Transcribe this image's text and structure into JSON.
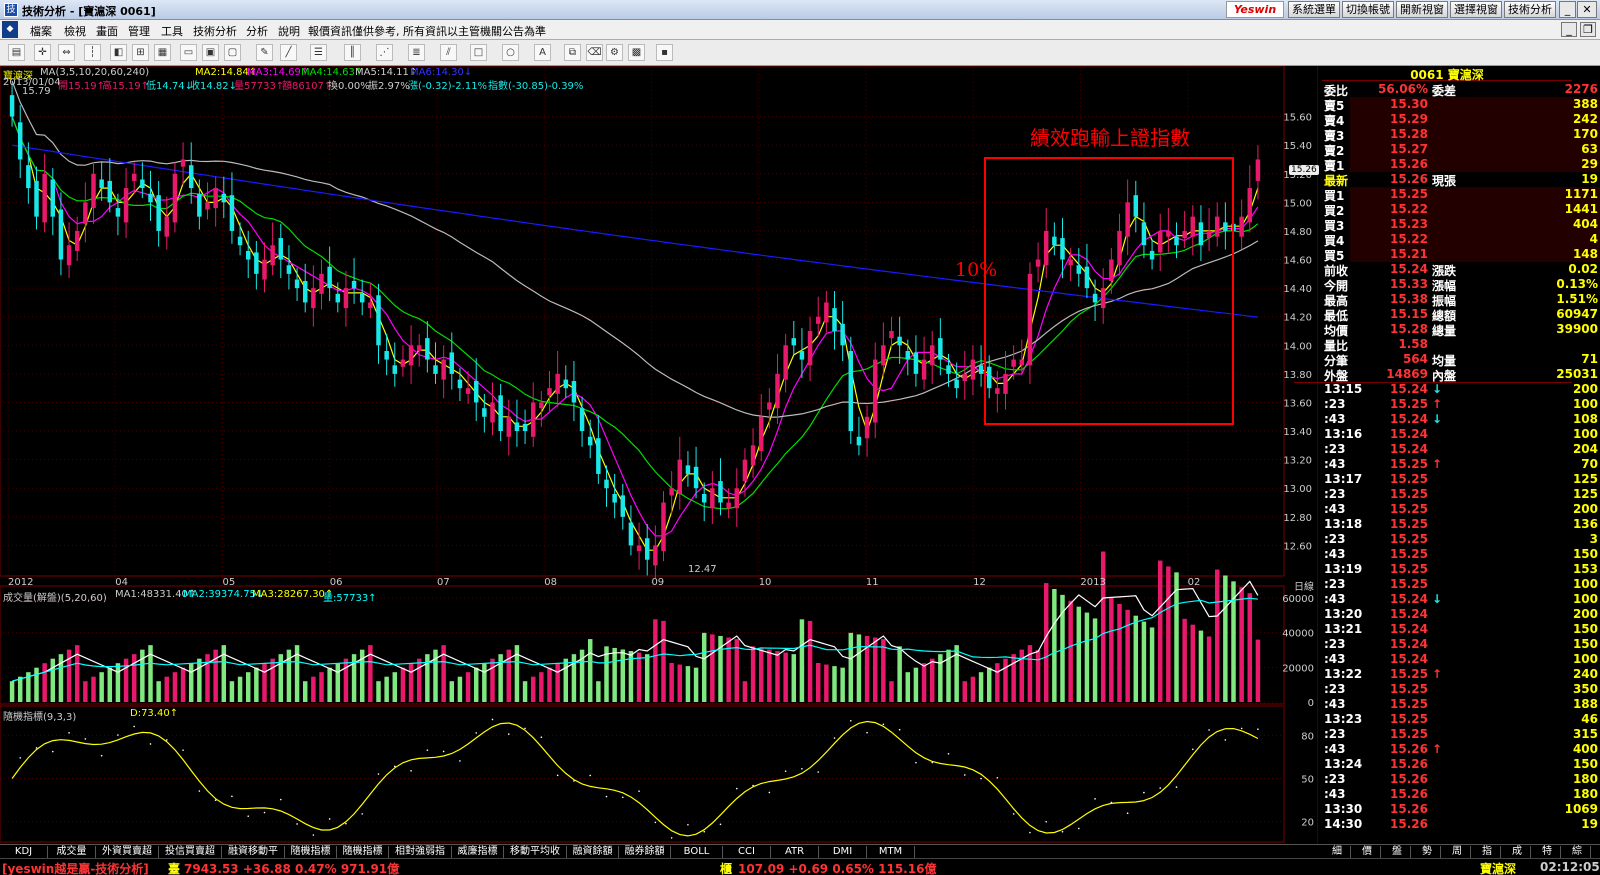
{
  "window": {
    "title": "技術分析 - [寶滬深 0061]",
    "brand": "Yeswin",
    "top_buttons": [
      "系統選單",
      "切換帳號",
      "開新視窗",
      "選擇視窗",
      "技術分析"
    ]
  },
  "menu": {
    "items": [
      "檔案",
      "檢視",
      "畫面",
      "管理",
      "工具",
      "技術分析",
      "分析",
      "說明"
    ],
    "notice": "報價資訊僅供參考, 所有資訊以主管機關公告為準"
  },
  "chart": {
    "info_line1": {
      "name": "寶滬深",
      "ma_label": "MA(3,5,10,20,60,240)",
      "ma2": "MA2:14.84↑",
      "ma3": "MA3:14.69↑",
      "ma4": "MA4:14.63↑",
      "ma5": "MA5:14.11↑",
      "ma6": "MA6:14.30↓"
    },
    "info_line2": {
      "date": "2013/01/04",
      "open": "開15.19↑",
      "high": "高15.19↑",
      "low": "低14.74↓",
      "close": "收14.82↓",
      "vol": "量57733↑",
      "amt": "額86107↑",
      "turn": "換0.00%",
      "amp": "振2.97%",
      "chg": "漲(-0.32)-2.11%",
      "idx": "指數(-30.85)-0.39%"
    },
    "high_marker": "15.79",
    "low_marker": "12.47",
    "price_axis": [
      "15.60",
      "15.40",
      "15.20",
      "15.00",
      "14.80",
      "14.60",
      "14.40",
      "14.20",
      "14.00",
      "13.80",
      "13.60",
      "13.40",
      "13.20",
      "13.00",
      "12.80",
      "12.60"
    ],
    "current_price_tag": "15.26",
    "x_axis": [
      "2012",
      "04",
      "05",
      "06",
      "07",
      "08",
      "09",
      "10",
      "11",
      "12",
      "2013",
      "02"
    ],
    "x_axis_unit": "日線",
    "annotation_title": "績效跑輸上證指數",
    "annotation_pct": "10%",
    "volume_title": "成交量(解盤)(5,20,60)",
    "vol_ma1": "MA1:48331.40↑",
    "vol_ma2": "MA2:39374.75↓",
    "vol_ma3": "MA3:28267.30↑",
    "vol_now": "量:57733↑",
    "volume_axis": [
      "60000",
      "40000",
      "20000",
      "0"
    ],
    "kd_title": "隨機指標(9,3,3)",
    "kd_d": "D:73.40↑",
    "kd_axis": [
      "80",
      "50",
      "20"
    ],
    "colors": {
      "up": "#e8196b",
      "down": "#19e8e8",
      "ma3": "#ffff00",
      "ma5": "#ff00ff",
      "ma20": "#00dd00",
      "ma60": "#bbbbbb",
      "ma240": "#1a1aff",
      "box": "#ff0000"
    }
  },
  "chart_data": {
    "type": "candlestick",
    "title": "寶滬深",
    "xlabel": "",
    "ylabel": "",
    "ylim": [
      12.4,
      15.8
    ],
    "x_ticks": [
      "2012",
      "04",
      "05",
      "06",
      "07",
      "08",
      "09",
      "10",
      "11",
      "12",
      "2013",
      "02"
    ],
    "notes": "Daily candlesticks approx. Mar-2012 to Feb-2013; high 15.79, low 12.47; MA240 falls from ~15.4 to ~14.2.",
    "closes": [
      15.6,
      15.3,
      15.1,
      14.9,
      15.2,
      14.9,
      14.6,
      14.7,
      14.8,
      15.0,
      15.2,
      15.1,
      15.0,
      14.9,
      15.1,
      15.2,
      15.1,
      15.0,
      14.8,
      14.9,
      15.2,
      15.3,
      15.1,
      14.9,
      15.0,
      15.1,
      15.0,
      14.8,
      14.7,
      14.6,
      14.5,
      14.6,
      14.7,
      14.6,
      14.5,
      14.4,
      14.3,
      14.4,
      14.5,
      14.4,
      14.3,
      14.4,
      14.4,
      14.3,
      14.3,
      14.0,
      13.9,
      13.8,
      13.9,
      14.0,
      14.0,
      13.9,
      13.8,
      13.9,
      13.8,
      13.7,
      13.7,
      13.6,
      13.5,
      13.6,
      13.4,
      13.5,
      13.4,
      13.4,
      13.6,
      13.6,
      13.7,
      13.8,
      13.7,
      13.6,
      13.4,
      13.3,
      13.1,
      13.0,
      12.9,
      12.8,
      12.6,
      12.6,
      12.5,
      12.6,
      12.9,
      13.0,
      13.2,
      13.1,
      13.0,
      12.9,
      13.0,
      12.9,
      12.9,
      13.0,
      13.2,
      13.3,
      13.5,
      13.6,
      13.8,
      14.0,
      14.0,
      13.9,
      14.1,
      14.2,
      14.3,
      14.1,
      14.0,
      13.4,
      13.3,
      13.5,
      13.9,
      14.0,
      14.1,
      14.0,
      13.9,
      13.8,
      13.9,
      14.0,
      13.9,
      13.8,
      13.7,
      13.8,
      13.9,
      13.8,
      13.7,
      13.7,
      13.8,
      13.9,
      13.9,
      14.5,
      14.6,
      14.8,
      14.7,
      14.6,
      14.6,
      14.5,
      14.4,
      14.3,
      14.4,
      14.6,
      14.8,
      15.0,
      14.9,
      14.7,
      14.6,
      14.8,
      14.8,
      14.7,
      14.8,
      14.9,
      14.7,
      14.8,
      14.9,
      14.8,
      14.8,
      14.9,
      15.1,
      15.3
    ]
  },
  "panel": {
    "header": "0061 寶滬深",
    "commission_ratio": {
      "l": "委比",
      "v": "56.06%",
      "l2": "委差",
      "v2": "2276"
    },
    "asks": [
      {
        "l": "賣5",
        "p": "15.30",
        "q": "388"
      },
      {
        "l": "賣4",
        "p": "15.29",
        "q": "242"
      },
      {
        "l": "賣3",
        "p": "15.28",
        "q": "170"
      },
      {
        "l": "賣2",
        "p": "15.27",
        "q": "63"
      },
      {
        "l": "賣1",
        "p": "15.26",
        "q": "29"
      }
    ],
    "last": {
      "l": "最新",
      "p": "15.26",
      "l2": "現張",
      "q": "19"
    },
    "bids": [
      {
        "l": "買1",
        "p": "15.25",
        "q": "1171"
      },
      {
        "l": "買2",
        "p": "15.22",
        "q": "1441"
      },
      {
        "l": "買3",
        "p": "15.23",
        "q": "404"
      },
      {
        "l": "買4",
        "p": "15.22",
        "q": "4"
      },
      {
        "l": "買5",
        "p": "15.21",
        "q": "148"
      }
    ],
    "stats": [
      {
        "l": "前收",
        "v": "15.24",
        "l2": "漲跌",
        "v2": "0.02"
      },
      {
        "l": "今開",
        "v": "15.33",
        "l2": "漲幅",
        "v2": "0.13%"
      },
      {
        "l": "最高",
        "v": "15.38",
        "l2": "振幅",
        "v2": "1.51%"
      },
      {
        "l": "最低",
        "v": "15.15",
        "l2": "總額",
        "v2": "60947"
      },
      {
        "l": "均價",
        "v": "15.28",
        "l2": "總量",
        "v2": "39900"
      },
      {
        "l": "量比",
        "v": "1.58",
        "l2": "",
        "v2": ""
      },
      {
        "l": "分筆",
        "v": "564",
        "l2": "均量",
        "v2": "71"
      },
      {
        "l": "外盤",
        "v": "14869",
        "l2": "內盤",
        "v2": "25031"
      }
    ],
    "ticks": [
      {
        "t": "13:15",
        "p": "15.24",
        "a": "↓",
        "q": "200"
      },
      {
        "t": ":23",
        "p": "15.25",
        "a": "↑",
        "q": "100"
      },
      {
        "t": ":43",
        "p": "15.24",
        "a": "↓",
        "q": "108"
      },
      {
        "t": "13:16",
        "p": "15.24",
        "a": "",
        "q": "100"
      },
      {
        "t": ":23",
        "p": "15.24",
        "a": "",
        "q": "204"
      },
      {
        "t": ":43",
        "p": "15.25",
        "a": "↑",
        "q": "70"
      },
      {
        "t": "13:17",
        "p": "15.25",
        "a": "",
        "q": "125"
      },
      {
        "t": ":23",
        "p": "15.25",
        "a": "",
        "q": "125"
      },
      {
        "t": ":43",
        "p": "15.25",
        "a": "",
        "q": "200"
      },
      {
        "t": "13:18",
        "p": "15.25",
        "a": "",
        "q": "136"
      },
      {
        "t": ":23",
        "p": "15.25",
        "a": "",
        "q": "3"
      },
      {
        "t": ":43",
        "p": "15.25",
        "a": "",
        "q": "150"
      },
      {
        "t": "13:19",
        "p": "15.25",
        "a": "",
        "q": "153"
      },
      {
        "t": ":23",
        "p": "15.25",
        "a": "",
        "q": "100"
      },
      {
        "t": ":43",
        "p": "15.24",
        "a": "↓",
        "q": "100"
      },
      {
        "t": "13:20",
        "p": "15.24",
        "a": "",
        "q": "200"
      },
      {
        "t": "13:21",
        "p": "15.24",
        "a": "",
        "q": "150"
      },
      {
        "t": ":23",
        "p": "15.24",
        "a": "",
        "q": "150"
      },
      {
        "t": ":43",
        "p": "15.24",
        "a": "",
        "q": "100"
      },
      {
        "t": "13:22",
        "p": "15.25",
        "a": "↑",
        "q": "240"
      },
      {
        "t": ":23",
        "p": "15.25",
        "a": "",
        "q": "350"
      },
      {
        "t": ":43",
        "p": "15.25",
        "a": "",
        "q": "188"
      },
      {
        "t": "13:23",
        "p": "15.25",
        "a": "",
        "q": "46"
      },
      {
        "t": ":23",
        "p": "15.25",
        "a": "",
        "q": "315"
      },
      {
        "t": ":43",
        "p": "15.26",
        "a": "↑",
        "q": "400"
      },
      {
        "t": "13:24",
        "p": "15.26",
        "a": "",
        "q": "150"
      },
      {
        "t": ":23",
        "p": "15.26",
        "a": "",
        "q": "180"
      },
      {
        "t": ":43",
        "p": "15.26",
        "a": "",
        "q": "180"
      },
      {
        "t": "13:30",
        "p": "15.26",
        "a": "",
        "q": "1069"
      },
      {
        "t": "14:30",
        "p": "15.26",
        "a": "",
        "q": "19"
      }
    ],
    "tabs": [
      "細",
      "價",
      "盤",
      "勢",
      "周",
      "指",
      "成",
      "特",
      "綜"
    ]
  },
  "indicator_tabs": [
    "KDJ",
    "成交量",
    "外資買賣超",
    "投信買賣超",
    "融資移動平",
    "隨機指標",
    "隨機指標",
    "相對強弱指",
    "威廉指標",
    "移動平均收",
    "融資餘額",
    "融券餘額",
    "BOLL",
    "CCI",
    "ATR",
    "DMI",
    "MTM"
  ],
  "status": {
    "brand": "[yeswin越是贏-技術分析]",
    "idx1_label": "臺",
    "idx1": "7943.53 +36.88 0.47% 971.91億",
    "idx2_label": "櫃",
    "idx2": "107.09 +0.69 0.65% 115.16億",
    "stock": "寶滬深",
    "time": "02:12:05"
  }
}
